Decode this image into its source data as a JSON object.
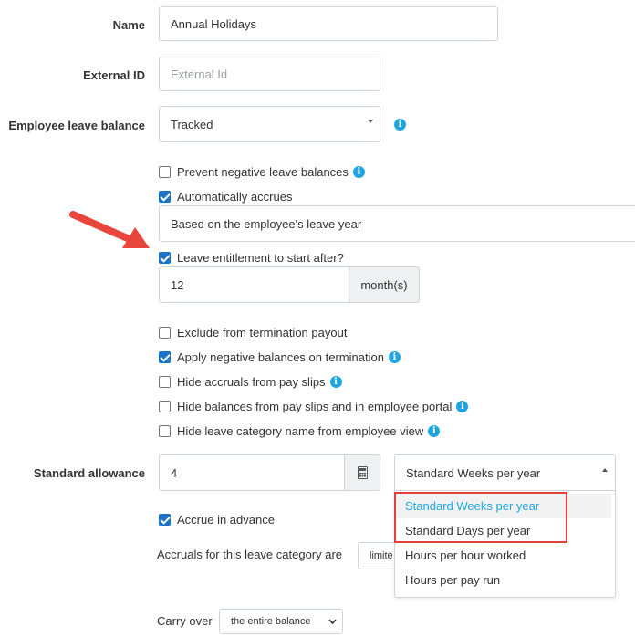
{
  "form": {
    "name": {
      "label": "Name",
      "value": "Annual Holidays"
    },
    "external_id": {
      "label": "External ID",
      "placeholder": "External Id"
    },
    "leave_balance": {
      "label": "Employee leave balance",
      "value": "Tracked",
      "icon": "info-icon"
    },
    "checkboxes_top": [
      {
        "label": "Prevent negative leave balances",
        "checked": false,
        "info": true
      },
      {
        "label": "Automatically accrues",
        "checked": true,
        "info": false
      }
    ],
    "accrual_basis": {
      "value": "Based on the employee's leave year"
    },
    "entitlement": {
      "label": "Leave entitlement to start after?",
      "checked": true
    },
    "entitlement_period": {
      "value": "12",
      "unit": "month(s)"
    },
    "checkboxes_bottom": [
      {
        "label": "Exclude from termination payout",
        "checked": false,
        "info": false
      },
      {
        "label": "Apply negative balances on termination",
        "checked": true,
        "info": true
      },
      {
        "label": "Hide accruals from pay slips",
        "checked": false,
        "info": true
      },
      {
        "label": "Hide balances from pay slips and in employee portal",
        "checked": false,
        "info": true
      },
      {
        "label": "Hide leave category name from employee view",
        "checked": false,
        "info": true
      }
    ],
    "standard_allowance": {
      "label": "Standard allowance",
      "value": "4",
      "unit_select": "Standard Weeks per year",
      "calculator_icon": "calculator-icon"
    },
    "unit_options": [
      {
        "label": "Standard Weeks per year",
        "selected": true
      },
      {
        "label": "Standard Days per year",
        "selected": false
      },
      {
        "label": "Hours per hour worked",
        "selected": false
      },
      {
        "label": "Hours per pay run",
        "selected": false
      }
    ],
    "accrue_in_advance": {
      "label": "Accrue in advance",
      "checked": true
    },
    "accruals": {
      "label": "Accruals for this leave category are",
      "value": "limite"
    },
    "carry_over": {
      "label": "Carry over",
      "value": "the entire balance"
    }
  },
  "annotations": {
    "arrow_color": "#e8453c",
    "highlight_color": "#e0413a"
  },
  "colors": {
    "accent": "#1fa6e0",
    "checkbox": "#1a73c9"
  }
}
